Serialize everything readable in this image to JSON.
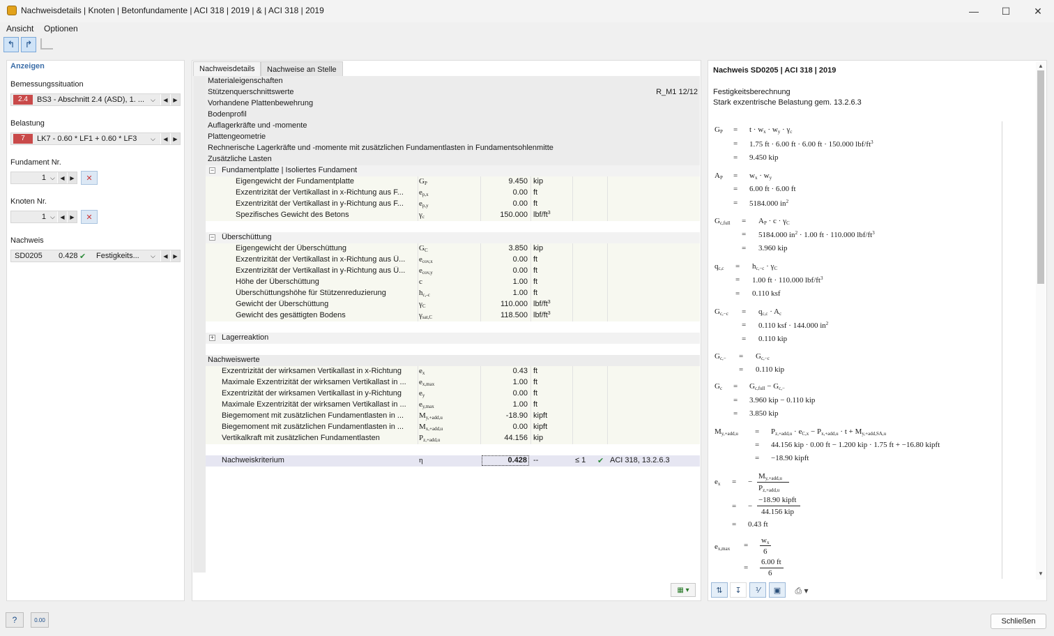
{
  "window": {
    "title": "Nachweisdetails | Knoten | Betonfundamente | ACI 318 | 2019 | & | ACI 318 | 2019"
  },
  "menu": [
    "Ansicht",
    "Optionen"
  ],
  "left": {
    "header": "Anzeigen",
    "design_situation_label": "Bemessungssituation",
    "design_situation_badge": "2.4",
    "design_situation_value": "BS3 - Abschnitt 2.4 (ASD), 1. ...",
    "loading_label": "Belastung",
    "loading_badge": "7",
    "loading_value": "LK7 - 0.60 * LF1 + 0.60 * LF3",
    "foundation_label": "Fundament Nr.",
    "foundation_value": "1",
    "node_label": "Knoten Nr.",
    "node_value": "1",
    "check_label": "Nachweis",
    "check_id": "SD0205",
    "check_ratio": "0.428",
    "check_type": "Festigkeits..."
  },
  "tabs": [
    "Nachweisdetails",
    "Nachweise an Stelle"
  ],
  "grid": {
    "collapsed_sections": [
      {
        "label": "Materialeigenschaften",
        "extra": ""
      },
      {
        "label": "Stützenquerschnittswerte",
        "extra": "R_M1 12/12"
      },
      {
        "label": "Vorhandene Plattenbewehrung",
        "extra": ""
      },
      {
        "label": "Bodenprofil",
        "extra": ""
      },
      {
        "label": "Auflagerkräfte und -momente",
        "extra": ""
      },
      {
        "label": "Plattengeometrie",
        "extra": ""
      },
      {
        "label": "Rechnerische Lagerkräfte und -momente mit zusätzlichen Fundamentlasten in Fundamentsohlenmitte",
        "extra": ""
      }
    ],
    "additional_loads": "Zusätzliche Lasten",
    "plate_group": "Fundamentplatte | Isoliertes Fundament",
    "plate_rows": [
      {
        "label": "Eigengewicht der Fundamentplatte",
        "sym": "G",
        "sub": "P",
        "val": "9.450",
        "unit": "kip",
        "sup": ""
      },
      {
        "label": "Exzentrizität der Vertikallast in x-Richtung aus F...",
        "sym": "e",
        "sub": "p,x",
        "val": "0.00",
        "unit": "ft",
        "sup": ""
      },
      {
        "label": "Exzentrizität der Vertikallast in y-Richtung aus F...",
        "sym": "e",
        "sub": "p,y",
        "val": "0.00",
        "unit": "ft",
        "sup": ""
      },
      {
        "label": "Spezifisches Gewicht des Betons",
        "sym": "γ",
        "sub": "c",
        "val": "150.000",
        "unit": "lbf/ft",
        "sup": "3"
      }
    ],
    "cover_group": "Überschüttung",
    "cover_rows": [
      {
        "label": "Eigengewicht der Überschüttung",
        "sym": "G",
        "sub": "C",
        "val": "3.850",
        "unit": "kip",
        "sup": ""
      },
      {
        "label": "Exzentrizität der Vertikallast in x-Richtung aus Ü...",
        "sym": "e",
        "sub": "cov,x",
        "val": "0.00",
        "unit": "ft",
        "sup": ""
      },
      {
        "label": "Exzentrizität der Vertikallast in y-Richtung aus Ü...",
        "sym": "e",
        "sub": "cov,y",
        "val": "0.00",
        "unit": "ft",
        "sup": ""
      },
      {
        "label": "Höhe der Überschüttung",
        "sym": "c",
        "sub": "",
        "val": "1.00",
        "unit": "ft",
        "sup": ""
      },
      {
        "label": "Überschüttungshöhe für Stützenreduzierung",
        "sym": "h",
        "sub": "c,-c",
        "val": "1.00",
        "unit": "ft",
        "sup": ""
      },
      {
        "label": "Gewicht der Überschüttung",
        "sym": "γ",
        "sub": "C",
        "val": "110.000",
        "unit": "lbf/ft",
        "sup": "3"
      },
      {
        "label": "Gewicht des gesättigten Bodens",
        "sym": "γ",
        "sub": "sat,C",
        "val": "118.500",
        "unit": "lbf/ft",
        "sup": "3"
      }
    ],
    "support_group": "Lagerreaktion",
    "checks_group": "Nachweiswerte",
    "check_rows": [
      {
        "label": "Exzentrizität der wirksamen Vertikallast in x-Richtung",
        "sym": "e",
        "sub": "x",
        "val": "0.43",
        "unit": "ft"
      },
      {
        "label": "Maximale Exzentrizität der wirksamen Vertikallast in ...",
        "sym": "e",
        "sub": "x,max",
        "val": "1.00",
        "unit": "ft"
      },
      {
        "label": "Exzentrizität der wirksamen Vertikallast in y-Richtung",
        "sym": "e",
        "sub": "y",
        "val": "0.00",
        "unit": "ft"
      },
      {
        "label": "Maximale Exzentrizität der wirksamen Vertikallast in ...",
        "sym": "e",
        "sub": "y,max",
        "val": "1.00",
        "unit": "ft"
      },
      {
        "label": "Biegemoment mit zusätzlichen Fundamentlasten in ...",
        "sym": "M",
        "sub": "y,+add,u",
        "val": "-18.90",
        "unit": "kipft"
      },
      {
        "label": "Biegemoment mit zusätzlichen Fundamentlasten in ...",
        "sym": "M",
        "sub": "x,+add,u",
        "val": "0.00",
        "unit": "kipft"
      },
      {
        "label": "Vertikalkraft mit zusätzlichen Fundamentlasten",
        "sym": "P",
        "sub": "z,+add,u",
        "val": "44.156",
        "unit": "kip"
      }
    ],
    "criterion": {
      "label": "Nachweiskriterium",
      "sym": "η",
      "val": "0.428",
      "unit": "--",
      "limit": "≤ 1",
      "ref": "ACI 318, 13.2.6.3"
    }
  },
  "right": {
    "title": "Nachweis SD0205 | ACI 318 | 2019",
    "line1": "Festigkeitsberechnung",
    "line2": "Stark exzentrische Belastung gem. 13.2.6.3"
  },
  "footer": {
    "close": "Schließen"
  }
}
